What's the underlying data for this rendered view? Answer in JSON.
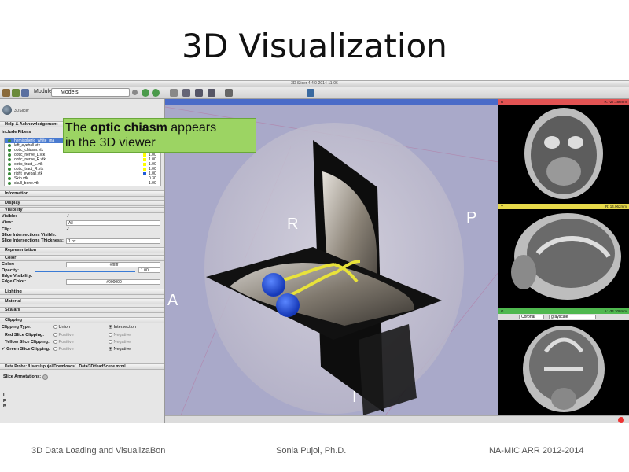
{
  "slide": {
    "title": "3D Visualization",
    "footer_left": "3D Data Loading and VisualizaBon",
    "footer_center": "Sonia Pujol, Ph.D.",
    "footer_right": "NA-MIC ARR 2012-2014"
  },
  "app": {
    "window_title": "3D Slicer 4.4.0-2014-11-06",
    "modules_label": "Modules:",
    "modules_value": "Models",
    "logo_text": "3DSlicer"
  },
  "left_panel": {
    "help_section": "Help & Acknowledgement",
    "include_fibers": "Include Fibers",
    "models": [
      {
        "name": "hemispheric_white_ma",
        "value": "",
        "color": "#7ea6e0",
        "selected": true
      },
      {
        "name": "left_eyeball.vtk",
        "value": "1.00",
        "color": "#ffffff"
      },
      {
        "name": "optic_chiasm.vtk",
        "value": "1.00",
        "color": "#ffff00"
      },
      {
        "name": "optic_nerve_L.vtk",
        "value": "1.00",
        "color": "#ffff00"
      },
      {
        "name": "optic_nerve_R.vtk",
        "value": "1.00",
        "color": "#ffff00"
      },
      {
        "name": "optic_tract_L.vtk",
        "value": "1.00",
        "color": "#ffff00"
      },
      {
        "name": "optic_tract_R.vtk",
        "value": "1.00",
        "color": "#ffff00"
      },
      {
        "name": "right_eyeball.vtk",
        "value": "1.00",
        "color": "#1f5bd6"
      },
      {
        "name": "Skin.vtk",
        "value": "0.30",
        "color": "#ffffff"
      },
      {
        "name": "skull_bone.vtk",
        "value": "1.00",
        "color": "#ffffff"
      }
    ],
    "sections": {
      "information": "Information",
      "display": "Display",
      "visibility": "Visibility",
      "representation": "Representation",
      "color": "Color",
      "lighting": "Lighting",
      "material": "Material",
      "scalars": "Scalars",
      "clipping": "Clipping"
    },
    "visibility": {
      "visible_label": "Visible:",
      "view_label": "View:",
      "view_value": "All",
      "clip_label": "Clip:",
      "slice_intersections_label": "Slice Intersections Visible:",
      "slice_thickness_label": "Slice Intersections Thickness:",
      "slice_thickness_value": "1 px"
    },
    "color": {
      "color_label": "Color:",
      "color_value": "#ffffff",
      "opacity_label": "Opacity:",
      "opacity_value": "1.00",
      "edge_visibility_label": "Edge Visibility:",
      "edge_color_label": "Edge Color:",
      "edge_color_value": "#000000"
    },
    "clipping": {
      "type_label": "Clipping Type:",
      "union": "Union",
      "intersection": "Intersection",
      "red_label": "Red Slice Clipping:",
      "yellow_label": "Yellow Slice Clipping:",
      "green_label": "Green Slice Clipping:",
      "positive": "Positive",
      "negative": "Negative"
    },
    "data_probe": "Data Probe: /Users/spujol/Downloads/...Data/3DHeadScene.mrml",
    "slice_annotations": "Slice Annotations:",
    "probe_letters": [
      "L",
      "F",
      "B"
    ]
  },
  "viewer3d": {
    "callout_normal_1": "The ",
    "callout_bold": "optic chiasm",
    "callout_normal_2": " appears",
    "callout_line2": "in the 3D viewer",
    "labels": {
      "R": "R",
      "P": "P",
      "A": "A",
      "I": "I"
    }
  },
  "slice_views": [
    {
      "id": "R",
      "readout": "R: -27.186mm",
      "color": "#e25353"
    },
    {
      "id": "Y",
      "readout": "R: 14.062mm",
      "color": "#e7d94a"
    },
    {
      "id": "G",
      "readout": "A: -34.308mm",
      "color": "#4fb84f",
      "orientation": "Coronal",
      "volume": "grayscale"
    }
  ],
  "colors": {
    "callout_bg": "#9cd463",
    "viewer_bg": "#a9a9c9",
    "viewer_bar": "#4a6bc8"
  }
}
